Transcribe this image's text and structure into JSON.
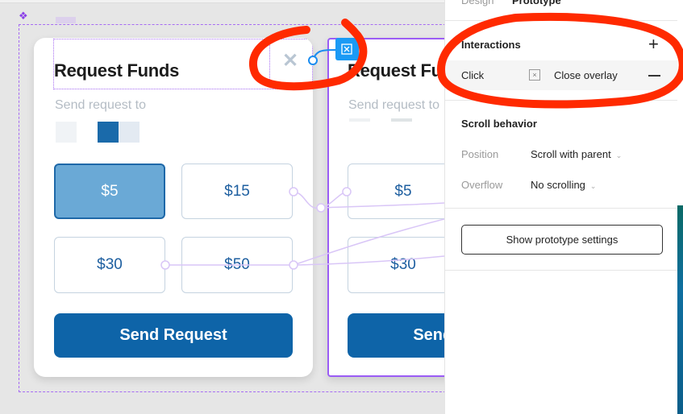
{
  "card": {
    "title": "Request Funds",
    "subtitle": "Send request to",
    "amounts": [
      "$5",
      "$15",
      "$30",
      "$50"
    ],
    "selected_amount": "$5",
    "send_label": "Send Request"
  },
  "panel": {
    "tabs": [
      "Design",
      "Prototype"
    ],
    "active_tab": "Prototype",
    "interactions": {
      "heading": "Interactions",
      "trigger": "Click",
      "action": "Close overlay"
    },
    "scroll": {
      "heading": "Scroll behavior",
      "position_label": "Position",
      "position_value": "Scroll with parent",
      "overflow_label": "Overflow",
      "overflow_value": "No scrolling"
    },
    "settings_button": "Show prototype settings"
  },
  "colors": {
    "accent": "#0e64a8",
    "selected_fill": "#6aa9d6",
    "frame_purple": "#a66cf2",
    "annotation_red": "#ff2a00"
  }
}
